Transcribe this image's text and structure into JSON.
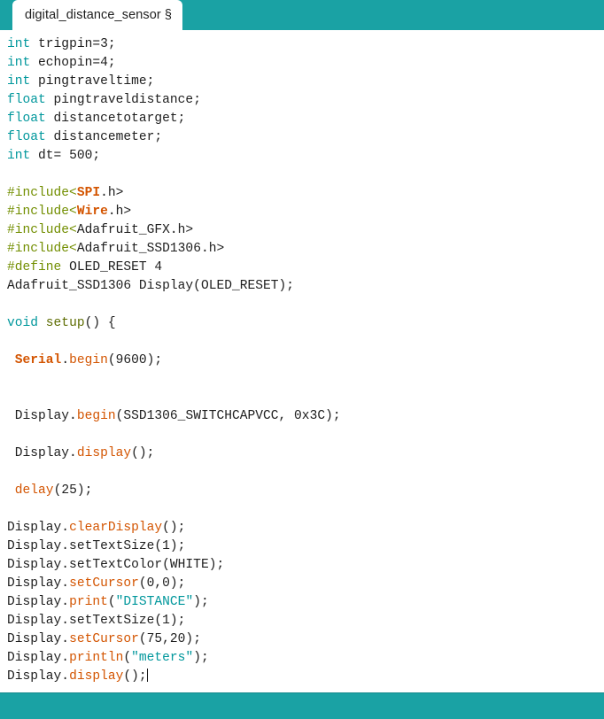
{
  "window": {
    "accent_color": "#1aa2a4",
    "editor_background": "#ffffff"
  },
  "tabbar": {
    "tabs": [
      {
        "label": "digital_distance_sensor",
        "modified_marker": "§",
        "active": true
      }
    ]
  },
  "editor": {
    "filename": "digital_distance_sensor",
    "caret_visible": true,
    "syntax_colors": {
      "keyword": "#00979c",
      "preprocessor": "#728e00",
      "library": "#d35400",
      "function": "#d35400",
      "setup_function": "#5e6d03",
      "string": "#00979c",
      "plain": "#1d1d1d"
    },
    "lines": [
      {
        "n": 1,
        "tokens": [
          {
            "t": "int",
            "c": "keyword"
          },
          {
            "t": " trigpin=3;",
            "c": "plain"
          }
        ]
      },
      {
        "n": 2,
        "tokens": [
          {
            "t": "int",
            "c": "keyword"
          },
          {
            "t": " echopin=4;",
            "c": "plain"
          }
        ]
      },
      {
        "n": 3,
        "tokens": [
          {
            "t": "int",
            "c": "keyword"
          },
          {
            "t": " pingtraveltime;",
            "c": "plain"
          }
        ]
      },
      {
        "n": 4,
        "tokens": [
          {
            "t": "float",
            "c": "keyword"
          },
          {
            "t": " pingtraveldistance;",
            "c": "plain"
          }
        ]
      },
      {
        "n": 5,
        "tokens": [
          {
            "t": "float",
            "c": "keyword"
          },
          {
            "t": " distancetotarget;",
            "c": "plain"
          }
        ]
      },
      {
        "n": 6,
        "tokens": [
          {
            "t": "float",
            "c": "keyword"
          },
          {
            "t": " distancemeter;",
            "c": "plain"
          }
        ]
      },
      {
        "n": 7,
        "tokens": [
          {
            "t": "int",
            "c": "keyword"
          },
          {
            "t": " dt= 500;",
            "c": "plain"
          }
        ]
      },
      {
        "n": 8,
        "tokens": []
      },
      {
        "n": 9,
        "tokens": [
          {
            "t": "#include<",
            "c": "preprocessor"
          },
          {
            "t": "SPI",
            "c": "library"
          },
          {
            "t": ".h>",
            "c": "plain"
          }
        ]
      },
      {
        "n": 10,
        "tokens": [
          {
            "t": "#include<",
            "c": "preprocessor"
          },
          {
            "t": "Wire",
            "c": "library"
          },
          {
            "t": ".h>",
            "c": "plain"
          }
        ]
      },
      {
        "n": 11,
        "tokens": [
          {
            "t": "#include<",
            "c": "preprocessor"
          },
          {
            "t": "Adafruit_GFX.h>",
            "c": "plain"
          }
        ]
      },
      {
        "n": 12,
        "tokens": [
          {
            "t": "#include<",
            "c": "preprocessor"
          },
          {
            "t": "Adafruit_SSD1306.h>",
            "c": "plain"
          }
        ]
      },
      {
        "n": 13,
        "tokens": [
          {
            "t": "#define",
            "c": "preprocessor"
          },
          {
            "t": " OLED_RESET 4",
            "c": "plain"
          }
        ]
      },
      {
        "n": 14,
        "tokens": [
          {
            "t": "Adafruit_SSD1306 Display(OLED_RESET);",
            "c": "plain"
          }
        ]
      },
      {
        "n": 15,
        "tokens": []
      },
      {
        "n": 16,
        "tokens": [
          {
            "t": "void",
            "c": "keyword"
          },
          {
            "t": " ",
            "c": "plain"
          },
          {
            "t": "setup",
            "c": "setup_function"
          },
          {
            "t": "() {",
            "c": "plain"
          }
        ]
      },
      {
        "n": 17,
        "tokens": []
      },
      {
        "n": 18,
        "tokens": [
          {
            "t": " ",
            "c": "plain"
          },
          {
            "t": "Serial",
            "c": "library"
          },
          {
            "t": ".",
            "c": "plain"
          },
          {
            "t": "begin",
            "c": "function"
          },
          {
            "t": "(9600);",
            "c": "plain"
          }
        ]
      },
      {
        "n": 19,
        "tokens": []
      },
      {
        "n": 20,
        "tokens": []
      },
      {
        "n": 21,
        "tokens": [
          {
            "t": " Display.",
            "c": "plain"
          },
          {
            "t": "begin",
            "c": "function"
          },
          {
            "t": "(SSD1306_SWITCHCAPVCC, 0x3C);",
            "c": "plain"
          }
        ]
      },
      {
        "n": 22,
        "tokens": []
      },
      {
        "n": 23,
        "tokens": [
          {
            "t": " Display.",
            "c": "plain"
          },
          {
            "t": "display",
            "c": "function"
          },
          {
            "t": "();",
            "c": "plain"
          }
        ]
      },
      {
        "n": 24,
        "tokens": []
      },
      {
        "n": 25,
        "tokens": [
          {
            "t": " ",
            "c": "plain"
          },
          {
            "t": "delay",
            "c": "function"
          },
          {
            "t": "(25);",
            "c": "plain"
          }
        ]
      },
      {
        "n": 26,
        "tokens": []
      },
      {
        "n": 27,
        "tokens": [
          {
            "t": "Display.",
            "c": "plain"
          },
          {
            "t": "clearDisplay",
            "c": "function"
          },
          {
            "t": "();",
            "c": "plain"
          }
        ]
      },
      {
        "n": 28,
        "tokens": [
          {
            "t": "Display.setTextSize(1);",
            "c": "plain"
          }
        ]
      },
      {
        "n": 29,
        "tokens": [
          {
            "t": "Display.setTextColor(WHITE);",
            "c": "plain"
          }
        ]
      },
      {
        "n": 30,
        "tokens": [
          {
            "t": "Display.",
            "c": "plain"
          },
          {
            "t": "setCursor",
            "c": "function"
          },
          {
            "t": "(0,0);",
            "c": "plain"
          }
        ]
      },
      {
        "n": 31,
        "tokens": [
          {
            "t": "Display.",
            "c": "plain"
          },
          {
            "t": "print",
            "c": "function"
          },
          {
            "t": "(",
            "c": "plain"
          },
          {
            "t": "\"DISTANCE\"",
            "c": "string"
          },
          {
            "t": ");",
            "c": "plain"
          }
        ]
      },
      {
        "n": 32,
        "tokens": [
          {
            "t": "Display.setTextSize(1);",
            "c": "plain"
          }
        ]
      },
      {
        "n": 33,
        "tokens": [
          {
            "t": "Display.",
            "c": "plain"
          },
          {
            "t": "setCursor",
            "c": "function"
          },
          {
            "t": "(75,20);",
            "c": "plain"
          }
        ]
      },
      {
        "n": 34,
        "tokens": [
          {
            "t": "Display.",
            "c": "plain"
          },
          {
            "t": "println",
            "c": "function"
          },
          {
            "t": "(",
            "c": "plain"
          },
          {
            "t": "\"meters\"",
            "c": "string"
          },
          {
            "t": ");",
            "c": "plain"
          }
        ]
      },
      {
        "n": 35,
        "tokens": [
          {
            "t": "Display.",
            "c": "plain"
          },
          {
            "t": "display",
            "c": "function"
          },
          {
            "t": "();",
            "c": "plain"
          },
          {
            "t": "",
            "c": "caret"
          }
        ]
      }
    ]
  },
  "footer": {
    "text": "",
    "color": "#1aa2a4"
  }
}
